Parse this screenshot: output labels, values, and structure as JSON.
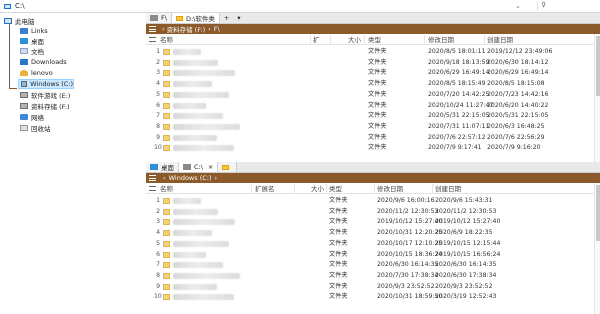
{
  "address_bar": {
    "path": "C:\\",
    "dropdown_icon": "chevron-down-icon",
    "filter_icon": "filter-icon"
  },
  "tree": [
    {
      "label": "此电脑",
      "icon": "pc-icon"
    },
    {
      "label": "Links",
      "icon": "folder-icon"
    },
    {
      "label": "桌面",
      "icon": "desktop-icon"
    },
    {
      "label": "文档",
      "icon": "document-icon"
    },
    {
      "label": "Downloads",
      "icon": "download-icon"
    },
    {
      "label": "lenovo",
      "icon": "user-icon"
    },
    {
      "label": "Windows (C:)",
      "icon": "drive-icon"
    },
    {
      "label": "软件游戏 (E:)",
      "icon": "drive-icon"
    },
    {
      "label": "资料存储 (F:)",
      "icon": "drive-icon"
    },
    {
      "label": "网络",
      "icon": "network-icon"
    },
    {
      "label": "回收站",
      "icon": "recycle-bin-icon"
    }
  ],
  "top_pane": {
    "tabs": [
      {
        "label": "F\\"
      },
      {
        "label": "D:\\软件类"
      },
      {
        "label": "+"
      },
      {
        "label": "▾"
      }
    ],
    "breadcrumb": [
      "资料存储 (F:)",
      "F\\"
    ],
    "columns": [
      "名称",
      "扩",
      "大小",
      "类型",
      "修改日期",
      "创建日期"
    ],
    "rows": [
      {
        "n": "1",
        "type": "文件夹",
        "modified": "2020/8/5 18:01:11",
        "created": "2019/12/12 23:49:06"
      },
      {
        "n": "2",
        "type": "文件夹",
        "modified": "2020/9/18 18:13:59",
        "created": "2020/6/30 18:14:12"
      },
      {
        "n": "3",
        "type": "文件夹",
        "modified": "2020/6/29 16:49:14",
        "created": "2020/6/29 16:49:14"
      },
      {
        "n": "4",
        "type": "文件夹",
        "modified": "2020/8/5 18:15:49",
        "created": "2020/8/5 18:15:08"
      },
      {
        "n": "5",
        "type": "文件夹",
        "modified": "2020/7/20 14:42:25",
        "created": "2020/7/23 14:42:16"
      },
      {
        "n": "6",
        "type": "文件夹",
        "modified": "2020/10/24 11:27:47",
        "created": "2020/6/20 14:40:22"
      },
      {
        "n": "7",
        "type": "文件夹",
        "modified": "2020/5/31 22:15:05",
        "created": "2020/5/31 22:15:05"
      },
      {
        "n": "8",
        "type": "文件夹",
        "modified": "2020/7/31 11:07:11",
        "created": "2020/6/3 16:48:25"
      },
      {
        "n": "9",
        "type": "文件夹",
        "modified": "2020/7/6 22:57:12",
        "created": "2020/7/6 22:56:29"
      },
      {
        "n": "10",
        "type": "文件夹",
        "modified": "2020/7/9 9:17:41",
        "created": "2020/7/9 9:16:20"
      }
    ]
  },
  "bottom_pane": {
    "tabs": [
      {
        "label": "桌面"
      },
      {
        "label": "C:\\"
      },
      {
        "label": "×"
      },
      {
        "label": ""
      }
    ],
    "breadcrumb": [
      "Windows (C:)"
    ],
    "columns": [
      "名称",
      "扩展名",
      "大小",
      "类型",
      "修改日期",
      "创建日期"
    ],
    "rows": [
      {
        "n": "1",
        "type": "文件夹",
        "modified": "2020/9/6 16:00:16",
        "created": "2020/9/6 15:43:31"
      },
      {
        "n": "2",
        "type": "文件夹",
        "modified": "2020/11/2 12:30:53",
        "created": "2020/11/2 12:30:53"
      },
      {
        "n": "3",
        "type": "文件夹",
        "modified": "2019/10/12 15:27:40",
        "created": "2019/10/12 15:27:40"
      },
      {
        "n": "4",
        "type": "文件夹",
        "modified": "2020/10/31 12:20:25",
        "created": "2020/6/9 18:22:35"
      },
      {
        "n": "5",
        "type": "文件夹",
        "modified": "2020/10/17 12:10:25",
        "created": "2019/10/15 12:15:44"
      },
      {
        "n": "6",
        "type": "文件夹",
        "modified": "2020/10/15 18:36:24",
        "created": "2019/10/15 16:56:24"
      },
      {
        "n": "7",
        "type": "文件夹",
        "modified": "2020/6/30 16:14:35",
        "created": "2020/6/30 16:14:35"
      },
      {
        "n": "8",
        "type": "文件夹",
        "modified": "2020/7/30 17:38:34",
        "created": "2020/6/30 17:38:34"
      },
      {
        "n": "9",
        "type": "文件夹",
        "modified": "2020/9/3 23:52:52",
        "created": "2020/9/3 23:52:52"
      },
      {
        "n": "10",
        "type": "文件夹",
        "modified": "2020/10/31 18:59:50",
        "created": "2020/3/19 12:52:43"
      }
    ]
  },
  "colors": {
    "path_bar": "#8b5a2b",
    "selection": "#cce8ff",
    "folder": "#f5c842",
    "accent": "#2f8fd6"
  }
}
